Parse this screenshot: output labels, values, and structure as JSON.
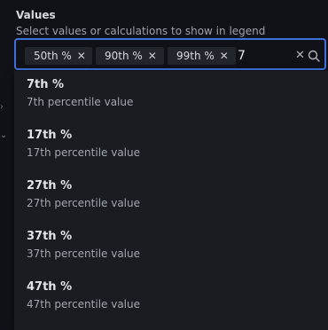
{
  "field": {
    "label": "Values",
    "description": "Select values or calculations to show in legend"
  },
  "select": {
    "chips": [
      {
        "label": "50th %"
      },
      {
        "label": "90th %"
      },
      {
        "label": "99th %"
      }
    ],
    "typed_value": "7",
    "clear_icon": "close-icon",
    "search_icon": "search-icon"
  },
  "options": [
    {
      "title": "7th %",
      "description": "7th percentile value"
    },
    {
      "title": "17th %",
      "description": "17th percentile value"
    },
    {
      "title": "27th %",
      "description": "27th percentile value"
    },
    {
      "title": "37th %",
      "description": "37th percentile value"
    },
    {
      "title": "47th %",
      "description": "47th percentile value"
    }
  ],
  "colors": {
    "focus_border": "#3d71d9",
    "menu_bg": "#1a1c21",
    "chip_bg": "#22252b"
  }
}
